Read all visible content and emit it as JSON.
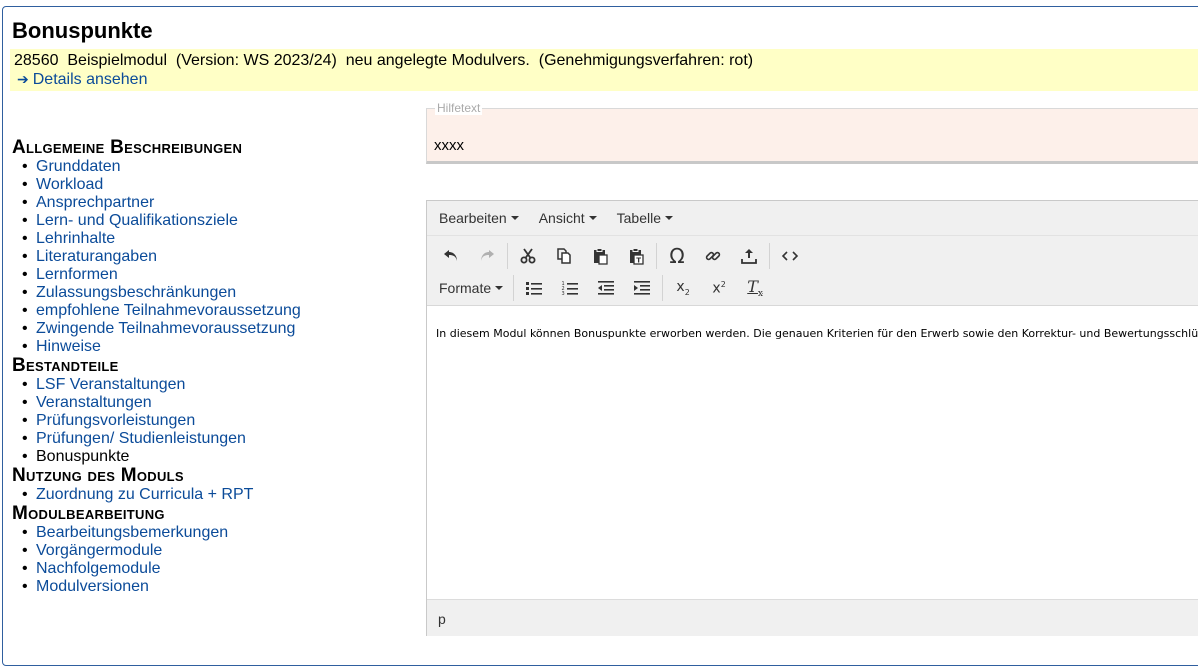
{
  "page_title": "Bonuspunkte",
  "info": {
    "line": "28560  Beispielmodul  (Version: WS 2023/24)  neu angelegte Modulvers.  (Genehmigungsverfahren: rot)",
    "details_link": "Details ansehen"
  },
  "nav": {
    "sections": [
      {
        "heading": "Allgemeine Beschreibungen",
        "items": [
          "Grunddaten",
          "Workload",
          "Ansprechpartner",
          "Lern- und Qualifikationsziele",
          "Lehrinhalte",
          "Literaturangaben",
          "Lernformen",
          "Zulassungsbeschränkungen",
          "empfohlene Teilnahmevoraussetzung",
          "Zwingende Teilnahmevoraussetzung",
          "Hinweise"
        ]
      },
      {
        "heading": "Bestandteile",
        "items": [
          "LSF Veranstaltungen",
          "Veranstaltungen",
          "Prüfungsvorleistungen",
          "Prüfungen/ Studienleistungen",
          "Bonuspunkte"
        ]
      },
      {
        "heading": "Nutzung des Moduls",
        "items": [
          "Zuordnung zu Curricula + RPT"
        ]
      },
      {
        "heading": "Modulbearbeitung",
        "items": [
          "Bearbeitungsbemerkungen",
          "Vorgängermodule",
          "Nachfolgemodule",
          "Modulversionen"
        ]
      }
    ],
    "current_item": "Bonuspunkte"
  },
  "hilfetext": {
    "legend": "Hilfetext",
    "text": "xxxx"
  },
  "editor": {
    "menu": [
      "Bearbeiten",
      "Ansicht",
      "Tabelle"
    ],
    "format_label": "Formate",
    "content": "In diesem Modul können Bonuspunkte erworben werden. Die genauen Kriterien für den Erwerb sowie den Korrektur- und Bewertungsschlüssel geben die Lehrenden zu Beginn der Veranstaltung bekannt.",
    "status_path": "p",
    "icons_row1": [
      "undo-icon",
      "redo-icon",
      "cut-icon",
      "copy-icon",
      "paste-icon",
      "paste-text-icon",
      "special-char-icon",
      "link-icon",
      "upload-icon",
      "source-code-icon"
    ],
    "icons_row2": [
      "bullet-list-icon",
      "numbered-list-icon",
      "outdent-icon",
      "indent-icon",
      "subscript-icon",
      "superscript-icon",
      "clear-format-icon"
    ]
  }
}
